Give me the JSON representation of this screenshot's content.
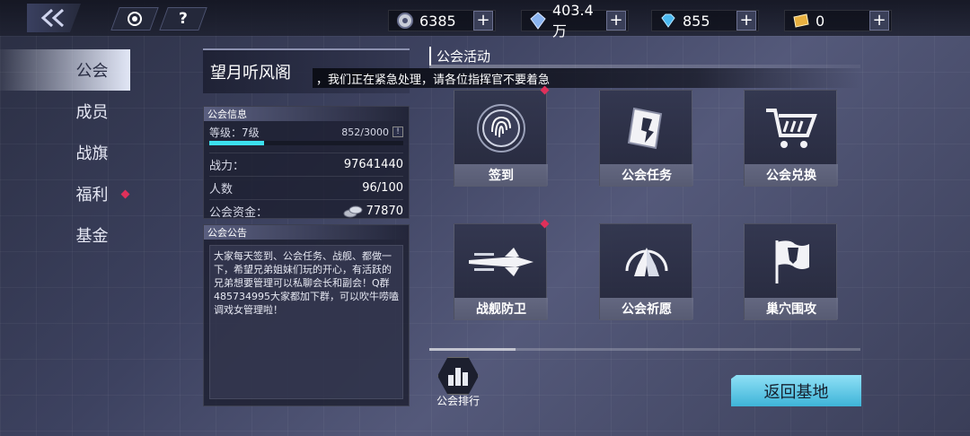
{
  "topbar": {
    "resources": [
      {
        "name": "power-core",
        "value": "6385"
      },
      {
        "name": "crystal",
        "value": "403.4万"
      },
      {
        "name": "diamond",
        "value": "855"
      },
      {
        "name": "ticket",
        "value": "0"
      }
    ],
    "plus_label": "+",
    "help_label": "?"
  },
  "sidebar": {
    "items": [
      {
        "label": "公会"
      },
      {
        "label": "成员"
      },
      {
        "label": "战旗"
      },
      {
        "label": "福利"
      },
      {
        "label": "基金"
      }
    ]
  },
  "guild": {
    "name": "望月听风阁",
    "notice_banner": "，我们正在紧急处理，请各位指挥官不要着急",
    "info_header": "公会信息",
    "level_label": "等级：7级",
    "exp": "852/3000",
    "exp_fraction": 0.284,
    "power_label": "战力：",
    "power_value": "97641440",
    "members_label": "人数",
    "members_value": "96/100",
    "funds_label": "公会资金：",
    "funds_value": "77870",
    "notice_header": "公会公告",
    "notice_text": "大家每天签到、公会任务、战舰、都做一下，希望兄弟姐妹们玩的开心，有活跃的兄弟想要管理可以私聊会长和副会！Q群485734995大家都加下群，可以吹牛唠嗑调戏女管理啦！"
  },
  "activities": {
    "title": "公会活动",
    "tiles": [
      {
        "label": "签到",
        "icon": "fingerprint-icon"
      },
      {
        "label": "公会任务",
        "icon": "task-scroll-icon"
      },
      {
        "label": "公会兑换",
        "icon": "shopping-cart-icon"
      },
      {
        "label": "战舰防卫",
        "icon": "battleship-icon"
      },
      {
        "label": "公会祈愿",
        "icon": "praying-hands-icon"
      },
      {
        "label": "巢穴围攻",
        "icon": "flag-icon"
      }
    ],
    "rank_label": "公会排行",
    "home_label": "返回基地"
  },
  "colors": {
    "accent": "#3ce0ee",
    "home_button": "#5ec8e6",
    "alert_dot": "#e0305a"
  }
}
